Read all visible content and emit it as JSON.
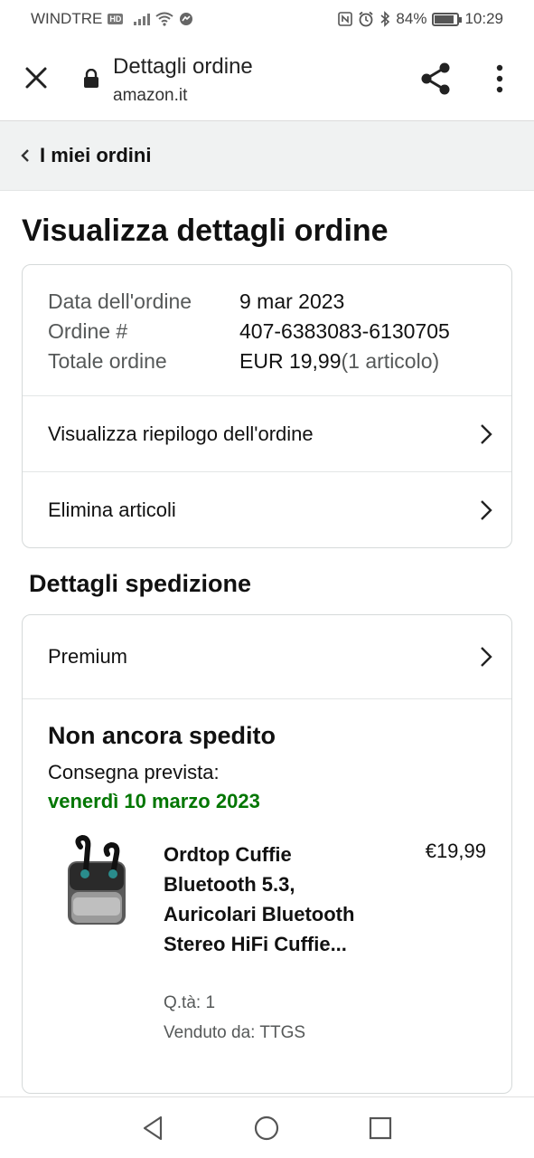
{
  "status_bar": {
    "carrier": "WINDTRE",
    "network_badge": "HD",
    "battery": "84%",
    "time": "10:29",
    "icons": [
      "signal-icon",
      "wifi-icon",
      "messenger-icon",
      "nfc-icon",
      "alarm-icon",
      "bluetooth-icon",
      "battery-icon"
    ]
  },
  "browser": {
    "title": "Dettagli ordine",
    "url": "amazon.it",
    "icons": [
      "close-icon",
      "lock-icon",
      "share-icon",
      "more-vert-icon"
    ]
  },
  "breadcrumb": {
    "label": "I miei ordini",
    "icon": "chevron-left-icon"
  },
  "page_title": "Visualizza dettagli ordine",
  "order_summary": {
    "rows": [
      {
        "label": "Data dell'ordine",
        "value": "9 mar 2023",
        "extra": ""
      },
      {
        "label": "Ordine #",
        "value": "407-6383083-6130705",
        "extra": ""
      },
      {
        "label": "Totale ordine",
        "value": "EUR 19,99",
        "extra": " (1 articolo)"
      }
    ],
    "actions": [
      {
        "label": "Visualizza riepilogo dell'ordine"
      },
      {
        "label": "Elimina articoli"
      }
    ]
  },
  "shipping": {
    "section_title": "Dettagli spedizione",
    "method": "Premium",
    "status": "Non ancora spedito",
    "delivery_label": "Consegna prevista:",
    "delivery_date": "venerdì 10 marzo 2023",
    "delivery_date_color": "#007600",
    "item": {
      "title": "Ordtop Cuffie Bluetooth 5.3, Auricolari Bluetooth Stereo HiFi Cuffie...",
      "price": "€19,99",
      "qty": "Q.tà: 1",
      "seller": "Venduto da: TTGS"
    }
  },
  "nav_bar": {
    "icons": [
      "back-triangle-icon",
      "home-circle-icon",
      "recents-square-icon"
    ]
  }
}
